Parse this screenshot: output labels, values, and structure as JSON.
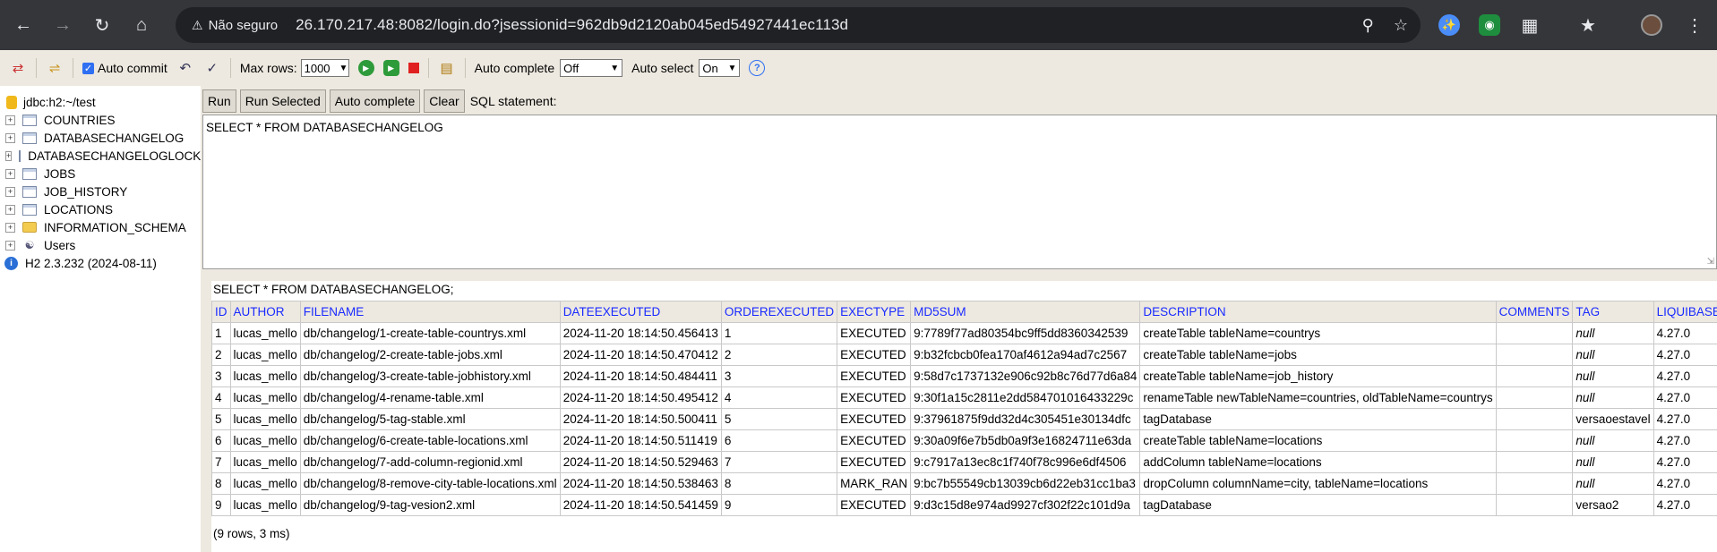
{
  "browser": {
    "security_label": "Não seguro",
    "url": "26.170.217.48:8082/login.do?jsessionid=962db9d2120ab045ed54927441ec113d"
  },
  "toolbar": {
    "auto_commit_label": "Auto commit",
    "auto_commit_checked": true,
    "max_rows_label": "Max rows:",
    "max_rows_value": "1000",
    "auto_complete_label": "Auto complete",
    "auto_complete_value": "Off",
    "auto_select_label": "Auto select",
    "auto_select_value": "On"
  },
  "tree": {
    "connection": "jdbc:h2:~/test",
    "tables": [
      "COUNTRIES",
      "DATABASECHANGELOG",
      "DATABASECHANGELOGLOCK",
      "JOBS",
      "JOB_HISTORY",
      "LOCATIONS"
    ],
    "schema": "INFORMATION_SCHEMA",
    "users": "Users",
    "version": "H2 2.3.232 (2024-08-11)"
  },
  "query": {
    "run": "Run",
    "run_selected": "Run Selected",
    "auto_complete": "Auto complete",
    "clear": "Clear",
    "sql_label": "SQL statement:",
    "sql_text": "SELECT * FROM DATABASECHANGELOG"
  },
  "result": {
    "sql": "SELECT * FROM DATABASECHANGELOG;",
    "columns": [
      "ID",
      "AUTHOR",
      "FILENAME",
      "DATEEXECUTED",
      "ORDEREXECUTED",
      "EXECTYPE",
      "MD5SUM",
      "DESCRIPTION",
      "COMMENTS",
      "TAG",
      "LIQUIBASE"
    ],
    "rows": [
      [
        "1",
        "lucas_mello",
        "db/changelog/1-create-table-countrys.xml",
        "2024-11-20 18:14:50.456413",
        "1",
        "EXECUTED",
        "9:7789f77ad80354bc9ff5dd8360342539",
        "createTable tableName=countrys",
        "",
        "null",
        "4.27.0"
      ],
      [
        "2",
        "lucas_mello",
        "db/changelog/2-create-table-jobs.xml",
        "2024-11-20 18:14:50.470412",
        "2",
        "EXECUTED",
        "9:b32fcbcb0fea170af4612a94ad7c2567",
        "createTable tableName=jobs",
        "",
        "null",
        "4.27.0"
      ],
      [
        "3",
        "lucas_mello",
        "db/changelog/3-create-table-jobhistory.xml",
        "2024-11-20 18:14:50.484411",
        "3",
        "EXECUTED",
        "9:58d7c1737132e906c92b8c76d77d6a84",
        "createTable tableName=job_history",
        "",
        "null",
        "4.27.0"
      ],
      [
        "4",
        "lucas_mello",
        "db/changelog/4-rename-table.xml",
        "2024-11-20 18:14:50.495412",
        "4",
        "EXECUTED",
        "9:30f1a15c2811e2dd584701016433229c",
        "renameTable newTableName=countries, oldTableName=countrys",
        "",
        "null",
        "4.27.0"
      ],
      [
        "5",
        "lucas_mello",
        "db/changelog/5-tag-stable.xml",
        "2024-11-20 18:14:50.500411",
        "5",
        "EXECUTED",
        "9:37961875f9dd32d4c305451e30134dfc",
        "tagDatabase",
        "",
        "versaoestavel",
        "4.27.0"
      ],
      [
        "6",
        "lucas_mello",
        "db/changelog/6-create-table-locations.xml",
        "2024-11-20 18:14:50.511419",
        "6",
        "EXECUTED",
        "9:30a09f6e7b5db0a9f3e16824711e63da",
        "createTable tableName=locations",
        "",
        "null",
        "4.27.0"
      ],
      [
        "7",
        "lucas_mello",
        "db/changelog/7-add-column-regionid.xml",
        "2024-11-20 18:14:50.529463",
        "7",
        "EXECUTED",
        "9:c7917a13ec8c1f740f78c996e6df4506",
        "addColumn tableName=locations",
        "",
        "null",
        "4.27.0"
      ],
      [
        "8",
        "lucas_mello",
        "db/changelog/8-remove-city-table-locations.xml",
        "2024-11-20 18:14:50.538463",
        "8",
        "MARK_RAN",
        "9:bc7b55549cb13039cb6d22eb31cc1ba3",
        "dropColumn columnName=city, tableName=locations",
        "",
        "null",
        "4.27.0"
      ],
      [
        "9",
        "lucas_mello",
        "db/changelog/9-tag-vesion2.xml",
        "2024-11-20 18:14:50.541459",
        "9",
        "EXECUTED",
        "9:d3c15d8e974ad9927cf302f22c101d9a",
        "tagDatabase",
        "",
        "versao2",
        "4.27.0"
      ]
    ],
    "footer": "(9 rows, 3 ms)"
  }
}
